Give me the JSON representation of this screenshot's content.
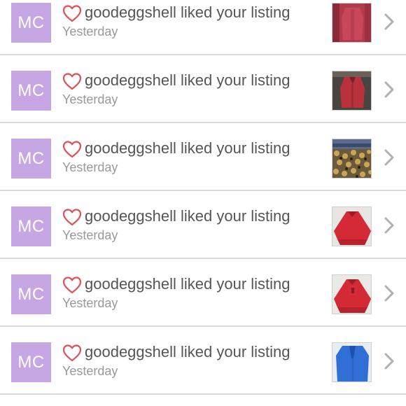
{
  "notifications": [
    {
      "avatar_text": "MC",
      "message": "goodeggshell liked your listing",
      "time": "Yesterday",
      "thumb": "red-top"
    },
    {
      "avatar_text": "MC",
      "message": "goodeggshell liked your listing",
      "time": "Yesterday",
      "thumb": "red-blouse-dark"
    },
    {
      "avatar_text": "MC",
      "message": "goodeggshell liked your listing",
      "time": "Yesterday",
      "thumb": "leopard-print"
    },
    {
      "avatar_text": "MC",
      "message": "goodeggshell liked your listing",
      "time": "Yesterday",
      "thumb": "red-poncho"
    },
    {
      "avatar_text": "MC",
      "message": "goodeggshell liked your listing",
      "time": "Yesterday",
      "thumb": "red-poncho"
    },
    {
      "avatar_text": "MC",
      "message": "goodeggshell liked your listing",
      "time": "Yesterday",
      "thumb": "blue-cardigan"
    }
  ],
  "colors": {
    "avatar_bg": "#c6a7e3",
    "heart": "#e0505a",
    "divider": "#d9d9d9",
    "chevron": "#b0b0b0"
  },
  "icons": {
    "like": "heart-outline-icon",
    "open": "chevron-right-icon"
  }
}
